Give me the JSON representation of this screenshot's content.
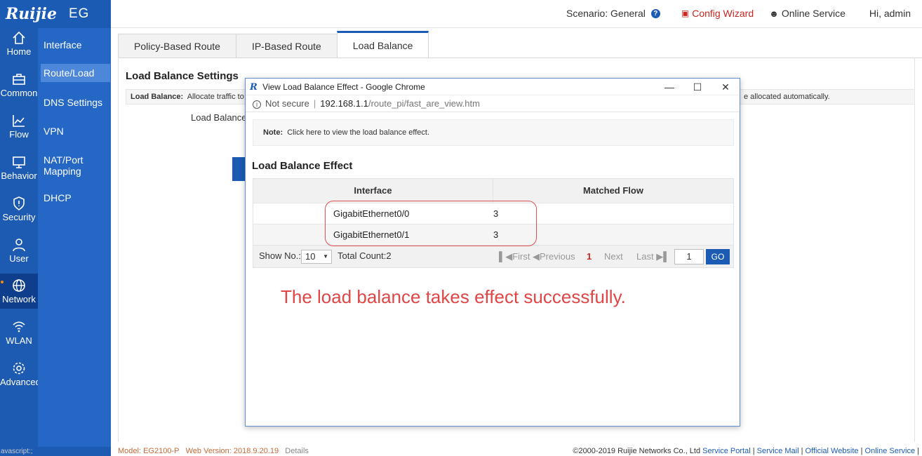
{
  "header": {
    "brand": "Ruijie",
    "product": "EG",
    "scenario_label": "Scenario:",
    "scenario_value": "General",
    "config_wizard": "Config Wizard",
    "online_service": "Online Service",
    "greeting": "Hi, admin"
  },
  "iconbar": {
    "items": [
      {
        "label": "Home",
        "icon": "home-icon"
      },
      {
        "label": "Common",
        "icon": "briefcase-icon"
      },
      {
        "label": "Flow",
        "icon": "chart-icon"
      },
      {
        "label": "Behavior",
        "icon": "monitor-icon"
      },
      {
        "label": "Security",
        "icon": "shield-icon"
      },
      {
        "label": "User",
        "icon": "user-icon"
      },
      {
        "label": "Network",
        "icon": "globe-icon"
      },
      {
        "label": "WLAN",
        "icon": "wifi-icon"
      },
      {
        "label": "Advanced",
        "icon": "gear-icon"
      }
    ],
    "active": "Network"
  },
  "submenu": {
    "items": [
      {
        "label": "Interface"
      },
      {
        "label": "Route/Load"
      },
      {
        "label": "DNS Settings"
      },
      {
        "label": "VPN"
      },
      {
        "label": "NAT/Port Mapping"
      },
      {
        "label": "DHCP"
      }
    ],
    "active": "Route/Load"
  },
  "tabs": [
    {
      "label": "Policy-Based Route"
    },
    {
      "label": "IP-Based Route"
    },
    {
      "label": "Load Balance"
    }
  ],
  "main": {
    "section_title": "Load Balance Settings",
    "note_label": "Load Balance:",
    "note_text": "Allocate traffic to",
    "note_tail": "e allocated automatically.",
    "lb_label": "Load Balance"
  },
  "popup": {
    "window_title": "View Load Balance Effect - Google Chrome",
    "security": "Not secure",
    "url_host": "192.168.1.1",
    "url_path": "/route_pi/fast_are_view.htm",
    "note_label": "Note:",
    "note_text": "Click here to view the load balance effect.",
    "heading": "Load Balance Effect",
    "table": {
      "headers": [
        "Interface",
        "Matched Flow"
      ],
      "rows": [
        {
          "interface": "GigabitEthernet0/0",
          "flow": "3"
        },
        {
          "interface": "GigabitEthernet0/1",
          "flow": "3"
        }
      ]
    },
    "pager": {
      "show_label": "Show No.:",
      "page_size": "10",
      "total": "Total Count:2",
      "first": "First",
      "previous": "Previous",
      "current": "1",
      "next": "Next",
      "last": "Last",
      "input": "1",
      "go": "GO"
    },
    "annotation": "The load balance takes effect successfully."
  },
  "footer": {
    "model": "Model: EG2100-P",
    "web_version": "Web Version: 2018.9.20.19",
    "details": "Details",
    "copyright": "©2000-2019 Ruijie Networks Co., Ltd",
    "links": [
      "Service Portal",
      "Service Mail",
      "Official Website",
      "Online Service"
    ],
    "left_stub": "avascript:;"
  },
  "colors": {
    "brand_blue": "#1b5bb4",
    "accent_red": "#c8261f",
    "annotation_red": "#e04646"
  }
}
